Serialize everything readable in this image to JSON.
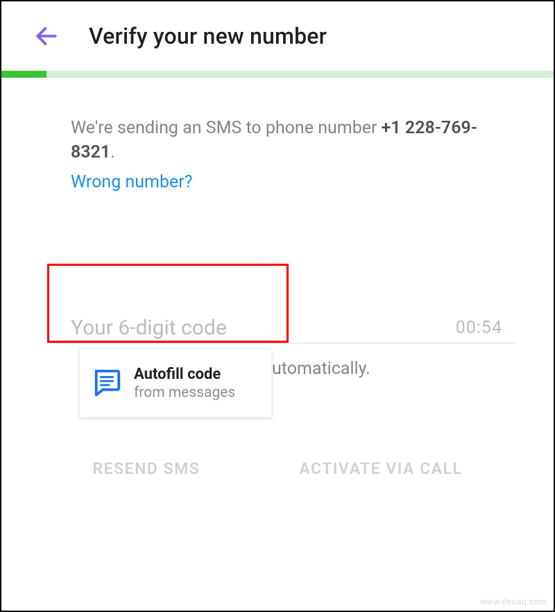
{
  "header": {
    "title": "Verify your new number"
  },
  "progress": {
    "percent": 8
  },
  "instructions": {
    "prefix": "We're sending an SMS to phone number ",
    "phone": "+1 228-769-8321",
    "suffix": ".",
    "wrong_number_link": "Wrong number?"
  },
  "code_input": {
    "placeholder": "Your 6-digit code",
    "timer": "00:54"
  },
  "autofill": {
    "title": "Autofill code",
    "subtitle": "from messages"
  },
  "background_text": "utomatically.",
  "actions": {
    "resend": "RESEND SMS",
    "call": "ACTIVATE VIA CALL"
  },
  "watermark": "www.deuaq.com"
}
